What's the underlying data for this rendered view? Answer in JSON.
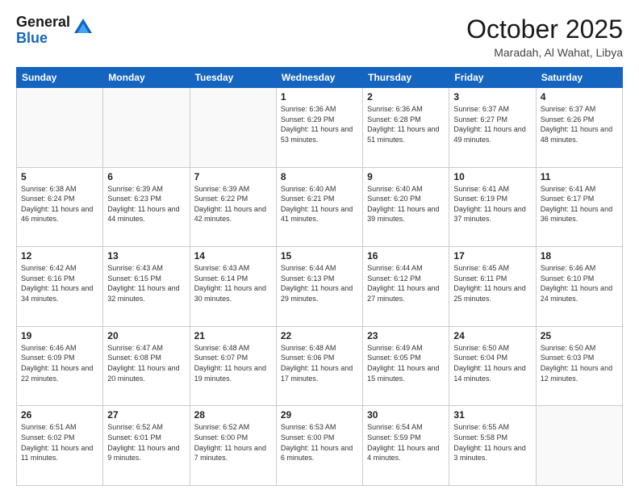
{
  "header": {
    "logo_general": "General",
    "logo_blue": "Blue",
    "month": "October 2025",
    "location": "Maradah, Al Wahat, Libya"
  },
  "days_of_week": [
    "Sunday",
    "Monday",
    "Tuesday",
    "Wednesday",
    "Thursday",
    "Friday",
    "Saturday"
  ],
  "weeks": [
    [
      {
        "day": "",
        "info": ""
      },
      {
        "day": "",
        "info": ""
      },
      {
        "day": "",
        "info": ""
      },
      {
        "day": "1",
        "info": "Sunrise: 6:36 AM\nSunset: 6:29 PM\nDaylight: 11 hours and 53 minutes."
      },
      {
        "day": "2",
        "info": "Sunrise: 6:36 AM\nSunset: 6:28 PM\nDaylight: 11 hours and 51 minutes."
      },
      {
        "day": "3",
        "info": "Sunrise: 6:37 AM\nSunset: 6:27 PM\nDaylight: 11 hours and 49 minutes."
      },
      {
        "day": "4",
        "info": "Sunrise: 6:37 AM\nSunset: 6:26 PM\nDaylight: 11 hours and 48 minutes."
      }
    ],
    [
      {
        "day": "5",
        "info": "Sunrise: 6:38 AM\nSunset: 6:24 PM\nDaylight: 11 hours and 46 minutes."
      },
      {
        "day": "6",
        "info": "Sunrise: 6:39 AM\nSunset: 6:23 PM\nDaylight: 11 hours and 44 minutes."
      },
      {
        "day": "7",
        "info": "Sunrise: 6:39 AM\nSunset: 6:22 PM\nDaylight: 11 hours and 42 minutes."
      },
      {
        "day": "8",
        "info": "Sunrise: 6:40 AM\nSunset: 6:21 PM\nDaylight: 11 hours and 41 minutes."
      },
      {
        "day": "9",
        "info": "Sunrise: 6:40 AM\nSunset: 6:20 PM\nDaylight: 11 hours and 39 minutes."
      },
      {
        "day": "10",
        "info": "Sunrise: 6:41 AM\nSunset: 6:19 PM\nDaylight: 11 hours and 37 minutes."
      },
      {
        "day": "11",
        "info": "Sunrise: 6:41 AM\nSunset: 6:17 PM\nDaylight: 11 hours and 36 minutes."
      }
    ],
    [
      {
        "day": "12",
        "info": "Sunrise: 6:42 AM\nSunset: 6:16 PM\nDaylight: 11 hours and 34 minutes."
      },
      {
        "day": "13",
        "info": "Sunrise: 6:43 AM\nSunset: 6:15 PM\nDaylight: 11 hours and 32 minutes."
      },
      {
        "day": "14",
        "info": "Sunrise: 6:43 AM\nSunset: 6:14 PM\nDaylight: 11 hours and 30 minutes."
      },
      {
        "day": "15",
        "info": "Sunrise: 6:44 AM\nSunset: 6:13 PM\nDaylight: 11 hours and 29 minutes."
      },
      {
        "day": "16",
        "info": "Sunrise: 6:44 AM\nSunset: 6:12 PM\nDaylight: 11 hours and 27 minutes."
      },
      {
        "day": "17",
        "info": "Sunrise: 6:45 AM\nSunset: 6:11 PM\nDaylight: 11 hours and 25 minutes."
      },
      {
        "day": "18",
        "info": "Sunrise: 6:46 AM\nSunset: 6:10 PM\nDaylight: 11 hours and 24 minutes."
      }
    ],
    [
      {
        "day": "19",
        "info": "Sunrise: 6:46 AM\nSunset: 6:09 PM\nDaylight: 11 hours and 22 minutes."
      },
      {
        "day": "20",
        "info": "Sunrise: 6:47 AM\nSunset: 6:08 PM\nDaylight: 11 hours and 20 minutes."
      },
      {
        "day": "21",
        "info": "Sunrise: 6:48 AM\nSunset: 6:07 PM\nDaylight: 11 hours and 19 minutes."
      },
      {
        "day": "22",
        "info": "Sunrise: 6:48 AM\nSunset: 6:06 PM\nDaylight: 11 hours and 17 minutes."
      },
      {
        "day": "23",
        "info": "Sunrise: 6:49 AM\nSunset: 6:05 PM\nDaylight: 11 hours and 15 minutes."
      },
      {
        "day": "24",
        "info": "Sunrise: 6:50 AM\nSunset: 6:04 PM\nDaylight: 11 hours and 14 minutes."
      },
      {
        "day": "25",
        "info": "Sunrise: 6:50 AM\nSunset: 6:03 PM\nDaylight: 11 hours and 12 minutes."
      }
    ],
    [
      {
        "day": "26",
        "info": "Sunrise: 6:51 AM\nSunset: 6:02 PM\nDaylight: 11 hours and 11 minutes."
      },
      {
        "day": "27",
        "info": "Sunrise: 6:52 AM\nSunset: 6:01 PM\nDaylight: 11 hours and 9 minutes."
      },
      {
        "day": "28",
        "info": "Sunrise: 6:52 AM\nSunset: 6:00 PM\nDaylight: 11 hours and 7 minutes."
      },
      {
        "day": "29",
        "info": "Sunrise: 6:53 AM\nSunset: 6:00 PM\nDaylight: 11 hours and 6 minutes."
      },
      {
        "day": "30",
        "info": "Sunrise: 6:54 AM\nSunset: 5:59 PM\nDaylight: 11 hours and 4 minutes."
      },
      {
        "day": "31",
        "info": "Sunrise: 6:55 AM\nSunset: 5:58 PM\nDaylight: 11 hours and 3 minutes."
      },
      {
        "day": "",
        "info": ""
      }
    ]
  ]
}
